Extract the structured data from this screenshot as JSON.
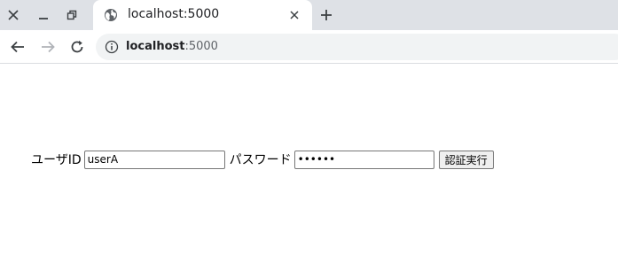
{
  "browser": {
    "tab": {
      "title": "localhost:5000"
    },
    "address_bar": {
      "host": "localhost",
      "port": ":5000"
    }
  },
  "form": {
    "user_id_label": "ユーザID",
    "user_id_value": "userA",
    "password_label": "パスワード",
    "password_value": "••••••",
    "submit_label": "認証実行"
  },
  "icons": {
    "window_close": "close-icon",
    "window_minimize": "minimize-icon",
    "window_restore": "restore-icon",
    "tab_favicon": "globe-icon",
    "tab_close": "close-icon",
    "new_tab": "plus-icon",
    "back": "arrow-left-icon",
    "forward": "arrow-right-icon",
    "reload": "reload-icon",
    "site_info": "info-icon"
  },
  "colors": {
    "tabstrip_bg": "#dee1e6",
    "omnibox_bg": "#f1f3f4",
    "text": "#202124"
  }
}
